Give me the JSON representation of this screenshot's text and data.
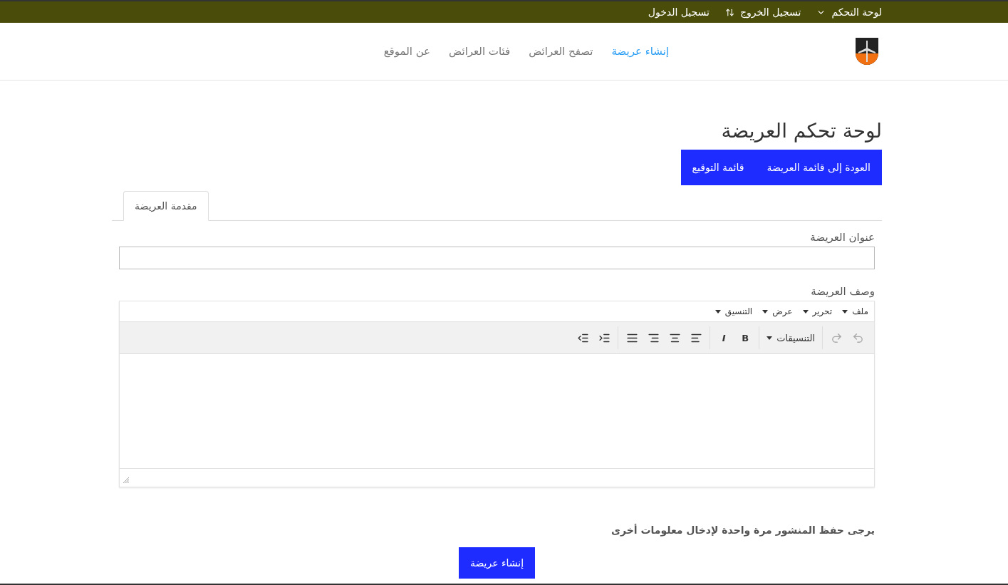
{
  "top_bar": {
    "items": [
      {
        "label": "لوحة التحكم",
        "kind": "dropdown"
      },
      {
        "label": "تسجيل الخروج",
        "kind": "sort"
      },
      {
        "label": "تسجيل الدخول",
        "kind": "plain"
      }
    ]
  },
  "nav": {
    "items": [
      {
        "label": "إنشاء عريضة",
        "selected": true
      },
      {
        "label": "تصفح العرائض",
        "selected": false
      },
      {
        "label": "فئات العرائض",
        "selected": false
      },
      {
        "label": "عن الموقع",
        "selected": false
      }
    ]
  },
  "page_title": "لوحة تحكم العريضة",
  "action_buttons": [
    "العودة إلى قائمة العريضة",
    "قائمة التوقيع"
  ],
  "tabs": [
    {
      "label": "مقدمة العريضة",
      "selected": true
    }
  ],
  "title_field": {
    "label": "عنوان العريضة"
  },
  "description_editor": {
    "label": "وصف العريضة",
    "menus": [
      "ملف",
      "تحرير",
      "عرض",
      "التنسيق"
    ],
    "tool_groups": [
      [
        {
          "kind": "undo",
          "disabled": true
        },
        {
          "kind": "redo",
          "disabled": true
        }
      ],
      [
        {
          "kind": "formats",
          "label": "التنسيقات"
        }
      ],
      [
        {
          "kind": "bold",
          "label": "B"
        },
        {
          "kind": "italic",
          "label": "I"
        }
      ],
      [
        {
          "kind": "alignleft"
        },
        {
          "kind": "aligncenter"
        },
        {
          "kind": "alignright"
        },
        {
          "kind": "justify"
        }
      ],
      [
        {
          "kind": "indent"
        },
        {
          "kind": "outdent"
        }
      ]
    ]
  },
  "notice": "يرجى حفظ المنشور مرة واحدة لإدخال معلومات أخرى",
  "submit_button": "إنشاء عريضة"
}
